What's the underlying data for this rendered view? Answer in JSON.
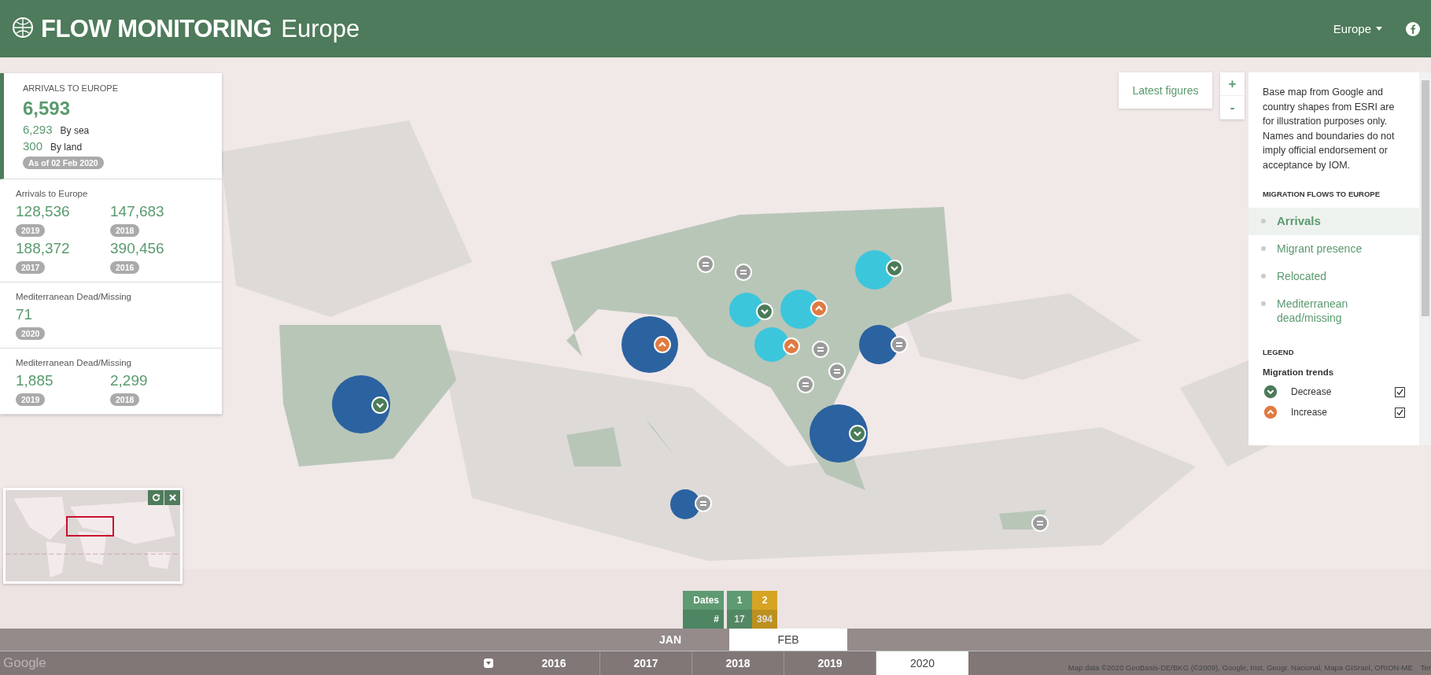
{
  "header": {
    "title_bold": "FLOW MONITORING",
    "title_light": "Europe",
    "region_menu": "Europe"
  },
  "stats": [
    {
      "kind": "headline",
      "title": "ARRIVALS TO EUROPE",
      "total": "6,593",
      "lines": [
        {
          "value": "6,293",
          "label": "By sea"
        },
        {
          "value": "300",
          "label": "By land"
        }
      ],
      "badge": "As of 02 Feb 2020"
    },
    {
      "kind": "grid",
      "title": "Arrivals to Europe",
      "items": [
        {
          "value": "128,536",
          "badge": "2019"
        },
        {
          "value": "147,683",
          "badge": "2018"
        },
        {
          "value": "188,372",
          "badge": "2017"
        },
        {
          "value": "390,456",
          "badge": "2016"
        }
      ]
    },
    {
      "kind": "grid",
      "title": "Mediterranean Dead/Missing",
      "items": [
        {
          "value": "71",
          "badge": "2020"
        }
      ]
    },
    {
      "kind": "grid",
      "title": "Mediterranean Dead/Missing",
      "items": [
        {
          "value": "1,885",
          "badge": "2019"
        },
        {
          "value": "2,299",
          "badge": "2018"
        }
      ]
    }
  ],
  "latest_button": "Latest figures",
  "zoom": {
    "in": "+",
    "out": "-"
  },
  "info": {
    "disclaimer": "Base map from Google and country shapes from ESRI are for illustration purposes only. Names and boundaries do not imply official endorsement or acceptance by IOM.",
    "flows_title": "MIGRATION FLOWS TO EUROPE",
    "flows": [
      {
        "label": "Arrivals",
        "selected": true
      },
      {
        "label": "Migrant presence",
        "selected": false
      },
      {
        "label": "Relocated",
        "selected": false
      },
      {
        "label": "Mediterranean dead/missing",
        "selected": false
      }
    ],
    "legend_title": "LEGEND",
    "legend_subtitle": "Migration trends",
    "legend": [
      {
        "label": "Decrease",
        "kind": "decrease",
        "checked": true
      },
      {
        "label": "Increase",
        "kind": "increase",
        "checked": true
      }
    ]
  },
  "markers": [
    {
      "color": "#2b62a0",
      "kind": "decrease"
    },
    {
      "color": "#2b62a0",
      "kind": "increase"
    },
    {
      "color": "#2b62a0",
      "kind": "stable"
    },
    {
      "color": "#2b62a0",
      "kind": "decrease"
    },
    {
      "color": "#2b62a0",
      "kind": "stable"
    },
    {
      "color": "#3cc6dc",
      "kind": "decrease"
    },
    {
      "color": "#3cc6dc",
      "kind": "increase"
    },
    {
      "color": "#3cc6dc",
      "kind": "decrease"
    },
    {
      "color": "#3cc6dc",
      "kind": "increase"
    },
    {
      "kind": "stable"
    },
    {
      "kind": "stable"
    },
    {
      "kind": "stable"
    },
    {
      "kind": "stable"
    },
    {
      "kind": "stable"
    },
    {
      "kind": "stable"
    }
  ],
  "dates_table": {
    "row_labels": [
      "Dates",
      "#"
    ],
    "columns": [
      {
        "date": "1",
        "count": "17",
        "color": "#5e9a72"
      },
      {
        "date": "2",
        "count": "394",
        "color": "#d6a423"
      }
    ]
  },
  "months": [
    {
      "label": "JAN",
      "selected": false
    },
    {
      "label": "FEB",
      "selected": true
    }
  ],
  "years": [
    {
      "label": "2016",
      "selected": false
    },
    {
      "label": "2017",
      "selected": false
    },
    {
      "label": "2018",
      "selected": false
    },
    {
      "label": "2019",
      "selected": false
    },
    {
      "label": "2020",
      "selected": true
    }
  ],
  "map_logo": "Google",
  "attribution": "Map data ©2020 GeoBasis-DE/BKG (©2009), Google, Inst. Geogr. Nacional, Mapa GISrael, ORION-ME",
  "terms": "Ter"
}
